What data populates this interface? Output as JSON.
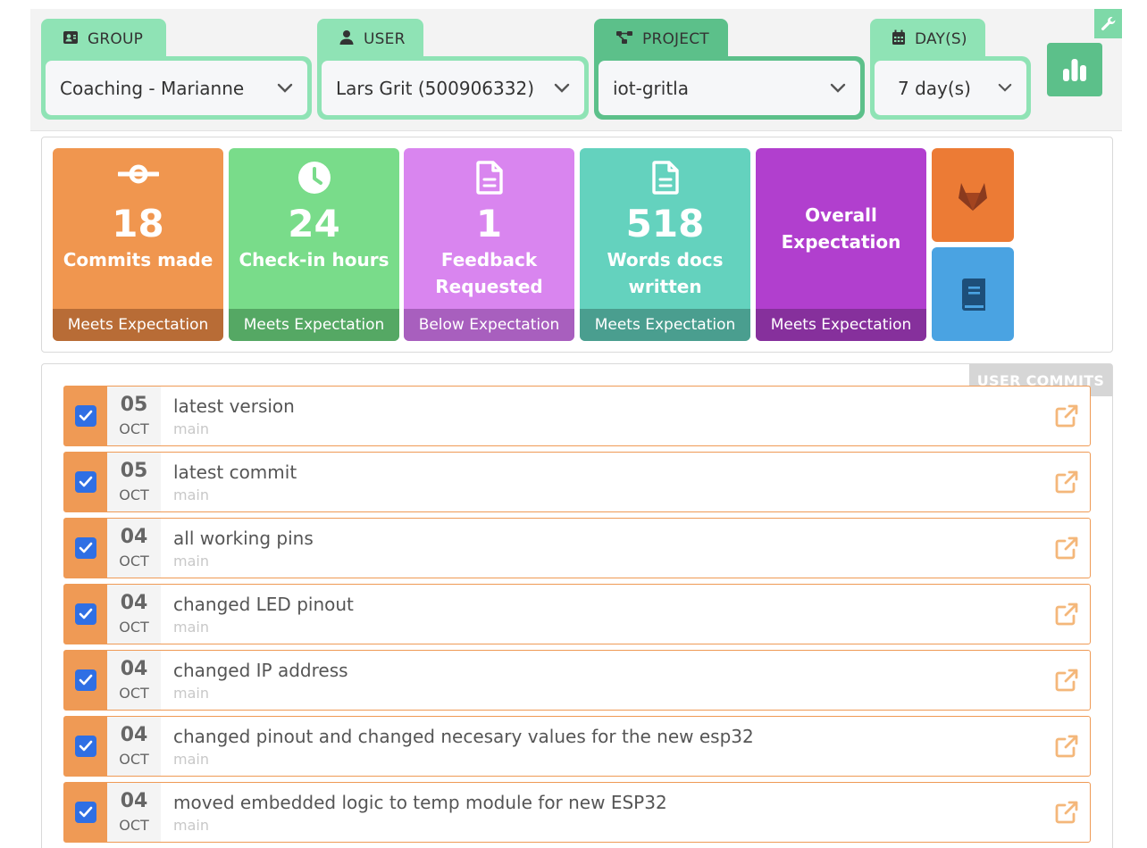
{
  "filters": {
    "group": {
      "label": "GROUP",
      "value": "Coaching - Marianne"
    },
    "user": {
      "label": "USER",
      "value": "Lars Grit (500906332)"
    },
    "project": {
      "label": "PROJECT",
      "value": "iot-gritla"
    },
    "days": {
      "label": "DAY(S)",
      "value": "7 day(s)"
    }
  },
  "stats": [
    {
      "value": "18",
      "label": "Commits made",
      "status": "Meets Expectation",
      "icon": "commit-icon",
      "color": "#f0964f",
      "status_color": "#b86c36"
    },
    {
      "value": "24",
      "label": "Check-in hours",
      "status": "Meets Expectation",
      "icon": "clock-icon",
      "color": "#79dc8a",
      "status_color": "#55a864"
    },
    {
      "value": "1",
      "label": "Feedback Requested",
      "status": "Below Expectation",
      "icon": "document-icon",
      "color": "#d985ef",
      "status_color": "#a85fbe"
    },
    {
      "value": "518",
      "label": "Words docs written",
      "status": "Meets Expectation",
      "icon": "document-icon",
      "color": "#64d2be",
      "status_color": "#4a9e8f"
    },
    {
      "value": "",
      "label": "Overall Expectation",
      "status": "Meets Expectation",
      "icon": "",
      "color": "#b13fce",
      "status_color": "#86309c"
    }
  ],
  "tiles": [
    {
      "icon": "gitlab-icon",
      "color": "#ec7b35"
    },
    {
      "icon": "book-icon",
      "color": "#4aa3e2"
    }
  ],
  "commits_title": "USER COMMITS",
  "commits": [
    {
      "day": "05",
      "month": "OCT",
      "message": "latest version",
      "branch": "main",
      "checked": true
    },
    {
      "day": "05",
      "month": "OCT",
      "message": "latest commit",
      "branch": "main",
      "checked": true
    },
    {
      "day": "04",
      "month": "OCT",
      "message": "all working pins",
      "branch": "main",
      "checked": true
    },
    {
      "day": "04",
      "month": "OCT",
      "message": "changed LED pinout",
      "branch": "main",
      "checked": true
    },
    {
      "day": "04",
      "month": "OCT",
      "message": "changed IP address",
      "branch": "main",
      "checked": true
    },
    {
      "day": "04",
      "month": "OCT",
      "message": "changed pinout and changed necesary values for the new esp32",
      "branch": "main",
      "checked": true
    },
    {
      "day": "04",
      "month": "OCT",
      "message": "moved embedded logic to temp module for new ESP32",
      "branch": "main",
      "checked": true
    }
  ]
}
